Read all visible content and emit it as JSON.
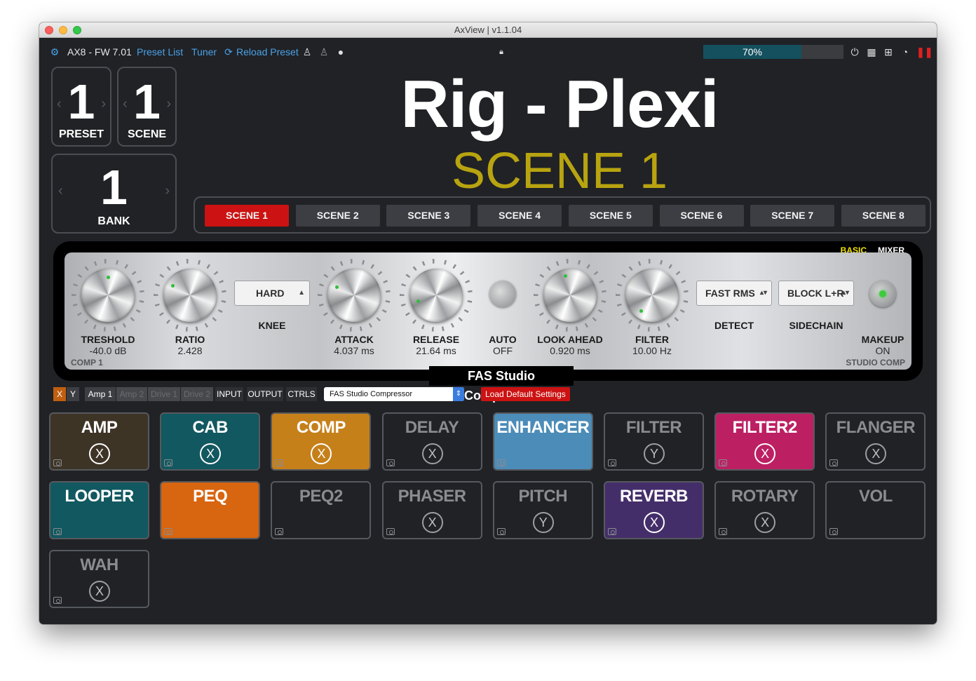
{
  "window": {
    "title": "AxView | v1.1.04"
  },
  "topbar": {
    "device": "AX8 - FW 7.01",
    "preset_list": "Preset List",
    "tuner": "Tuner",
    "reload_preset": "Reload Preset",
    "cpu": {
      "label": "70%",
      "value": 0.7
    }
  },
  "counters": {
    "preset": {
      "value": "1",
      "label": "PRESET"
    },
    "scene": {
      "value": "1",
      "label": "SCENE"
    },
    "bank": {
      "value": "1",
      "label": "BANK"
    }
  },
  "preset_name": "Rig - Plexi",
  "scene_title": "SCENE 1",
  "scenes": [
    "SCENE 1",
    "SCENE 2",
    "SCENE 3",
    "SCENE 4",
    "SCENE 5",
    "SCENE 6",
    "SCENE 7",
    "SCENE 8"
  ],
  "active_scene": 0,
  "editor": {
    "mode_basic": "BASIC",
    "mode_mixer": "MIXER",
    "block_label": "COMP 1",
    "type_label": "STUDIO COMP",
    "name": "FAS Studio Compressor",
    "params": {
      "threshold": {
        "label": "TRESHOLD",
        "value": "-40.0 dB"
      },
      "ratio": {
        "label": "RATIO",
        "value": "2.428"
      },
      "knee": {
        "label": "KNEE",
        "value": "HARD"
      },
      "attack": {
        "label": "ATTACK",
        "value": "4.037 ms"
      },
      "release": {
        "label": "RELEASE",
        "value": "21.64 ms"
      },
      "auto": {
        "label": "AUTO",
        "value": "OFF"
      },
      "look_ahead": {
        "label": "LOOK AHEAD",
        "value": "0.920 ms"
      },
      "filter": {
        "label": "FILTER",
        "value": "10.00 Hz"
      },
      "detect": {
        "label": "DETECT",
        "value": "FAST RMS"
      },
      "sidechain": {
        "label": "SIDECHAIN",
        "value": "BLOCK L+R"
      },
      "makeup": {
        "label": "MAKEUP",
        "value": "ON"
      }
    }
  },
  "toolbar": {
    "x": "X",
    "y": "Y",
    "amp1": "Amp 1",
    "amp2": "Amp 2",
    "drive1": "Drive 1",
    "drive2": "Drive 2",
    "input": "INPUT",
    "output": "OUTPUT",
    "ctrls": "CTRLS",
    "block_select": "FAS Studio Compressor",
    "load_default": "Load Default Settings"
  },
  "blocks": [
    {
      "name": "AMP",
      "xy": "X",
      "on": true,
      "color": "#3e3426"
    },
    {
      "name": "CAB",
      "xy": "X",
      "on": true,
      "color": "#125860"
    },
    {
      "name": "COMP",
      "xy": "X",
      "on": true,
      "color": "#c6801a"
    },
    {
      "name": "DELAY",
      "xy": "X",
      "on": false,
      "color": "#202226"
    },
    {
      "name": "ENHANCER",
      "xy": "",
      "on": true,
      "color": "#4c8cb8"
    },
    {
      "name": "FILTER",
      "xy": "Y",
      "on": false,
      "color": "#202226"
    },
    {
      "name": "FILTER2",
      "xy": "X",
      "on": true,
      "color": "#bc2063"
    },
    {
      "name": "FLANGER",
      "xy": "X",
      "on": false,
      "color": "#202226"
    },
    {
      "name": "LOOPER",
      "xy": "",
      "on": true,
      "color": "#125860"
    },
    {
      "name": "PEQ",
      "xy": "",
      "on": true,
      "color": "#d8650f"
    },
    {
      "name": "PEQ2",
      "xy": "",
      "on": false,
      "color": "#202226"
    },
    {
      "name": "PHASER",
      "xy": "X",
      "on": false,
      "color": "#202226"
    },
    {
      "name": "PITCH",
      "xy": "Y",
      "on": false,
      "color": "#202226"
    },
    {
      "name": "REVERB",
      "xy": "X",
      "on": true,
      "color": "#442e6a"
    },
    {
      "name": "ROTARY",
      "xy": "X",
      "on": false,
      "color": "#202226"
    },
    {
      "name": "VOL",
      "xy": "",
      "on": false,
      "color": "#202226"
    },
    {
      "name": "WAH",
      "xy": "X",
      "on": false,
      "color": "#202226"
    }
  ]
}
